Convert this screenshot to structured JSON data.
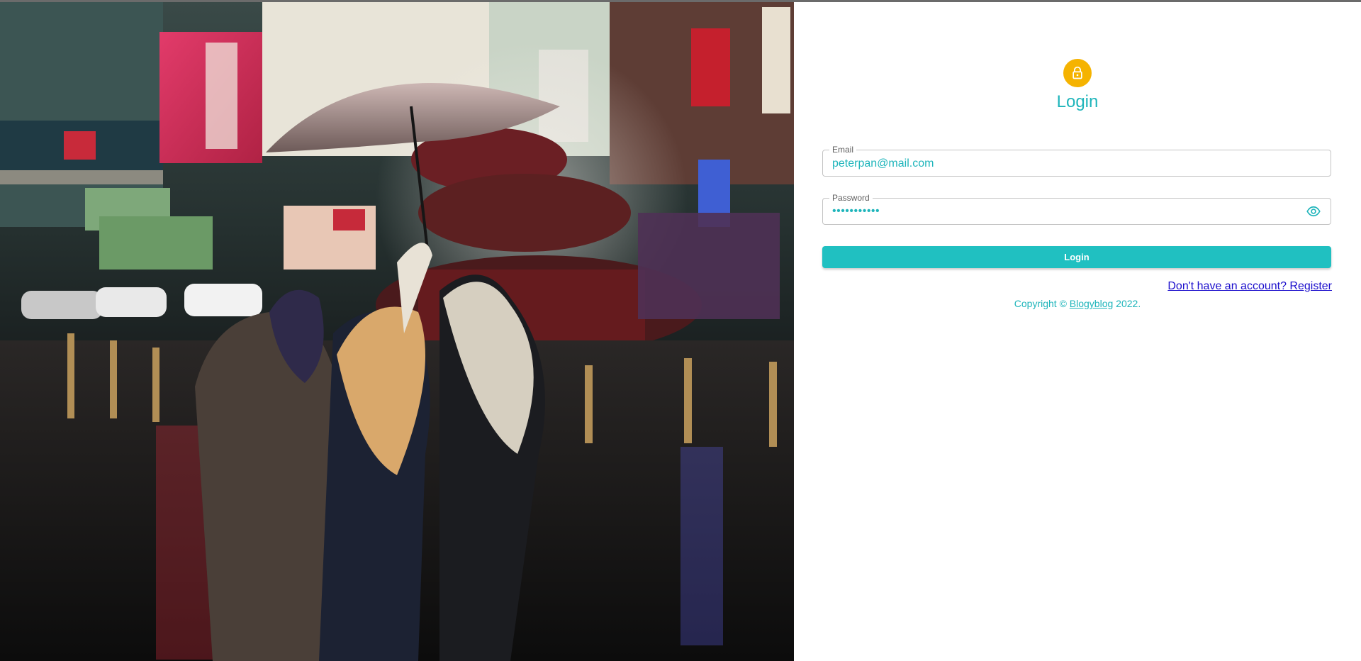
{
  "page": {
    "title": "Login",
    "hero_image": "rainy-city-street-with-umbrella"
  },
  "form": {
    "email": {
      "label": "Email",
      "value": "peterpan@mail.com"
    },
    "password": {
      "label": "Password",
      "masked_value": "•••••••••••",
      "toggle_icon": "eye-icon"
    },
    "submit_label": "Login",
    "register_link": "Don't have an account? Register"
  },
  "footer": {
    "copyright_prefix": "Copyright © ",
    "brand_link": "Blogyblog",
    "copyright_suffix": " 2022."
  },
  "colors": {
    "accent": "#1fb5bb",
    "button": "#20c0c1",
    "avatar": "#f5b301",
    "link": "#1a0dcc"
  }
}
